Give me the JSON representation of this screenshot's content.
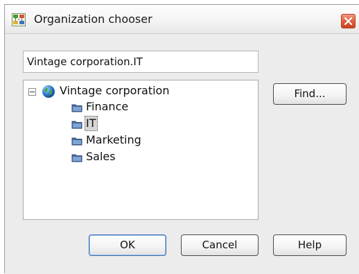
{
  "window": {
    "title": "Organization chooser",
    "title_icon": "organization-chart-icon",
    "close_icon": "close-icon"
  },
  "selection_field": {
    "value": "Vintage corporation.IT"
  },
  "tree": {
    "root": {
      "label": "Vintage corporation",
      "icon": "globe-icon",
      "expanded": true,
      "children": [
        {
          "label": "Finance",
          "icon": "folder-icon",
          "selected": false
        },
        {
          "label": "IT",
          "icon": "folder-icon",
          "selected": true
        },
        {
          "label": "Marketing",
          "icon": "folder-icon",
          "selected": false
        },
        {
          "label": "Sales",
          "icon": "folder-icon",
          "selected": false
        }
      ]
    }
  },
  "buttons": {
    "find": "Find...",
    "ok": "OK",
    "cancel": "Cancel",
    "help": "Help"
  },
  "colors": {
    "close_button": "#e0603f",
    "default_button_border": "#3b6fb6",
    "selection_highlight": "#d7d7d7"
  }
}
